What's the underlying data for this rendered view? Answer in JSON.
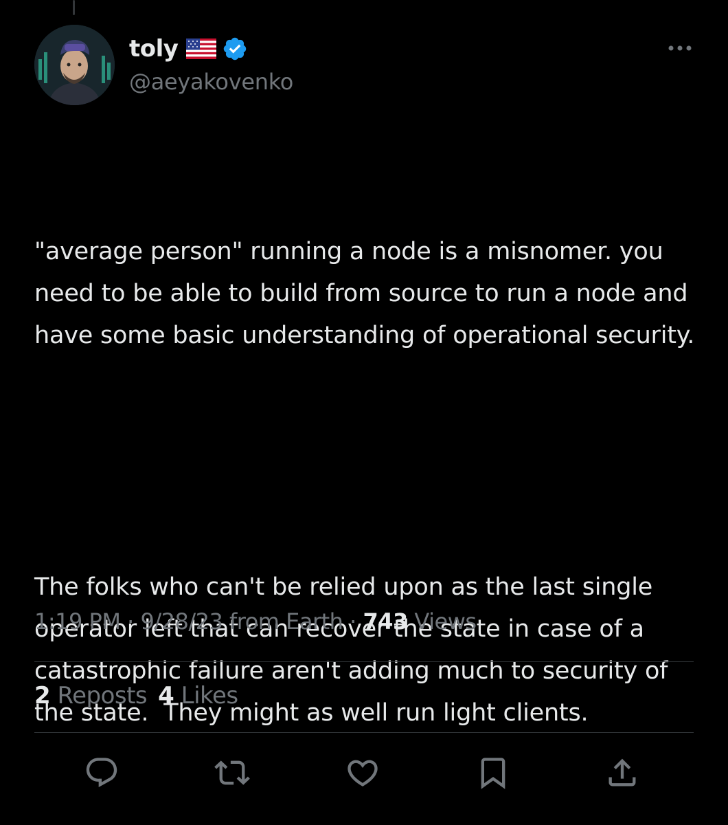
{
  "author": {
    "display_name": "toly",
    "flag_icon": "us-flag-icon",
    "verified_icon": "verified-badge-icon",
    "handle": "@aeyakovenko"
  },
  "tweet": {
    "paragraph1": "\"average person\" running a node is a misnomer. you need to be able to build from source to run a node and have some basic understanding of operational security.",
    "paragraph2": "The folks who can't be relied upon as the last single operator left that can recover the state in case of a catastrophic failure aren't adding much to security of the state.  They might as well run light clients."
  },
  "meta": {
    "time": "1:19 PM",
    "separator1": " · ",
    "date": "9/28/23",
    "source": " from Earth",
    "separator2": " · ",
    "views_count": "743",
    "views_label": " Views"
  },
  "stats": {
    "reposts_count": "2",
    "reposts_label": " Reposts",
    "likes_count": "4",
    "likes_label": " Likes"
  },
  "actions": [
    "reply-icon",
    "repost-icon",
    "like-icon",
    "bookmark-icon",
    "share-icon"
  ],
  "colors": {
    "background": "#000000",
    "text_primary": "#e7e9ea",
    "text_secondary": "#71767b",
    "verified_blue": "#1d9bf0",
    "divider": "#2f3336"
  }
}
